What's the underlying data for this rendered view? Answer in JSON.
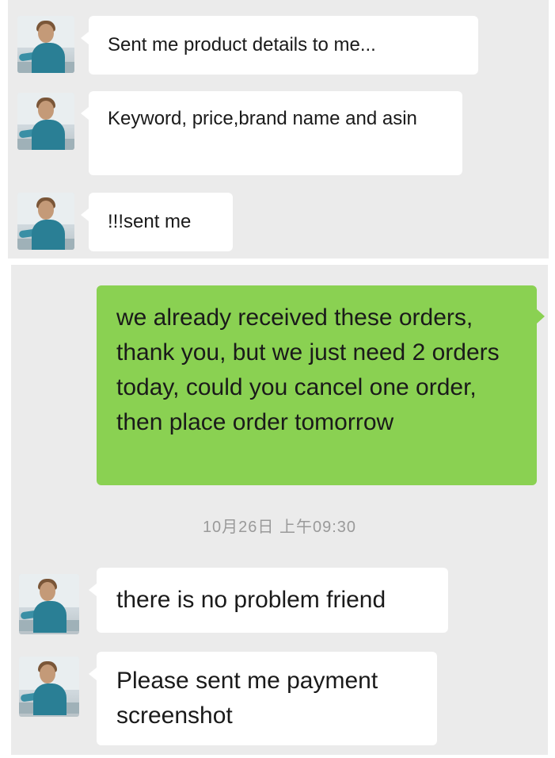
{
  "chat_top": {
    "messages": [
      {
        "sender": "contact",
        "text": "Sent me product details to me..."
      },
      {
        "sender": "contact",
        "text": "Keyword, price,brand name and asin"
      },
      {
        "sender": "contact",
        "text": "!!!sent me"
      }
    ]
  },
  "chat_bottom": {
    "outgoing": {
      "sender": "me",
      "text": "we already received these orders, thank you, but we just need 2 orders today, could you cancel one order, then place order tomorrow"
    },
    "timestamp": "10月26日 上午09:30",
    "messages": [
      {
        "sender": "contact",
        "text": "there is no problem friend"
      },
      {
        "sender": "contact",
        "text": "Please sent me payment screenshot"
      }
    ]
  },
  "colors": {
    "chat_background": "#ebebeb",
    "incoming_bubble": "#ffffff",
    "outgoing_bubble": "#8ad152"
  },
  "icons": {
    "contact_avatar": "contact-avatar-icon"
  }
}
